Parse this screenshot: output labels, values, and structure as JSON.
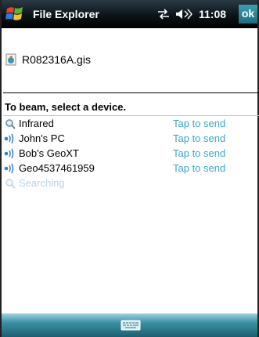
{
  "header": {
    "title": "File Explorer",
    "time": "11:08",
    "ok_label": "ok",
    "icons": [
      "start-menu-icon",
      "connectivity-icon",
      "volume-icon"
    ]
  },
  "file": {
    "name": "R082316A.gis",
    "icon": "gis-file-icon"
  },
  "prompt": "To beam, select a device.",
  "devices": [
    {
      "icon": "search-icon",
      "name": "Infrared",
      "action": "Tap to send"
    },
    {
      "icon": "bluetooth-device-icon",
      "name": "John's PC",
      "action": "Tap to send"
    },
    {
      "icon": "bluetooth-device-icon",
      "name": "Bob's GeoXT",
      "action": "Tap to send"
    },
    {
      "icon": "bluetooth-device-icon",
      "name": "Geo4537461959",
      "action": "Tap to send"
    },
    {
      "icon": "search-icon",
      "name": "Searching",
      "action": ""
    }
  ],
  "bottombar": {
    "keyboard_icon": "keyboard-icon"
  },
  "colors": {
    "title_bar": "#0c1418",
    "accent_link": "#3aa6cc",
    "bottom_bar": "#3b8fa3"
  }
}
